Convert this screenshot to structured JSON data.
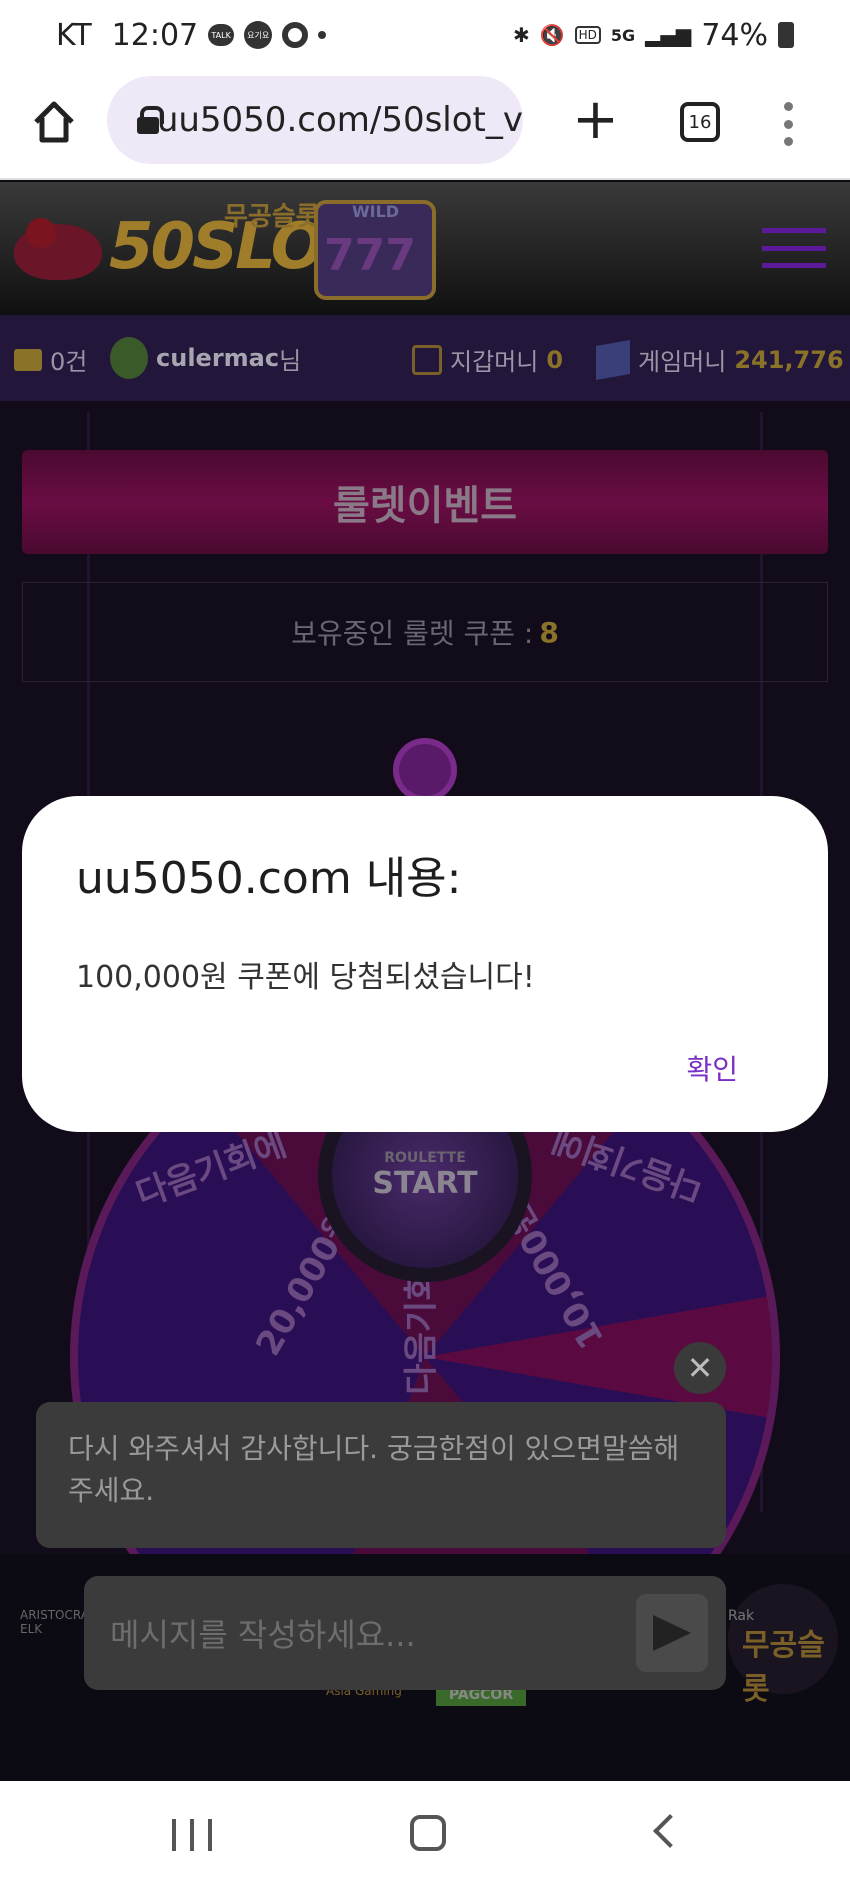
{
  "status_bar": {
    "carrier": "KT",
    "time": "12:07",
    "notification_icons": [
      "kakaotalk-icon",
      "yogiyo-icon",
      "camera-ring-icon",
      "more-dot-icon"
    ],
    "battery": "74%",
    "kakao_label": "TALK",
    "yogiyo_label": "요기요",
    "system_icons": [
      "bluetooth-icon",
      "mute-icon",
      "hd-icon",
      "5g-icon",
      "signal-icon",
      "battery-icon"
    ],
    "hd_label": "HD",
    "fiveg_label": "5G"
  },
  "browser": {
    "url": "uu5050.com/50slot_v",
    "tab_count": "16"
  },
  "site": {
    "logo_text": "50SLOT",
    "logo_sub": "무공슬롯",
    "logo_slot": "777",
    "logo_wild": "WILD",
    "info": {
      "mail_count": "0건",
      "username": "culermac",
      "username_suffix": "님",
      "wallet_label": "지갑머니",
      "wallet_value": "0",
      "game_label": "게임머니",
      "game_value": "241,776"
    },
    "event_title": "룰렛이벤트",
    "coupon_label": "보유중인 룰렛 쿠폰 :",
    "coupon_value": "8",
    "wheel": {
      "center_small": "ROULETTE",
      "center_big": "START",
      "segments": [
        "다음기회에",
        "20,000원",
        "다음기회에",
        "10,000원",
        "다음기회에"
      ]
    }
  },
  "chat": {
    "message": "다시 와주셔서 감사합니다. 궁금한점이 있으면말씀해주세요.",
    "input_placeholder": "메시지를 작성하세요..."
  },
  "footer": {
    "partner_left": "ARISTOCRAT ELK",
    "partner_right": "무공슬롯",
    "partner_right_small": "Rak",
    "pagcor": "PAGCOR",
    "pagcor_left": "Asia Gaming"
  },
  "dialog": {
    "title": "uu5050.com 내용:",
    "message": "100,000원 쿠폰에 당첨되셨습니다!",
    "ok_label": "확인"
  },
  "colors": {
    "accent": "#7a2fc2",
    "gold": "#8a7228",
    "banner": "#6a0c44"
  }
}
